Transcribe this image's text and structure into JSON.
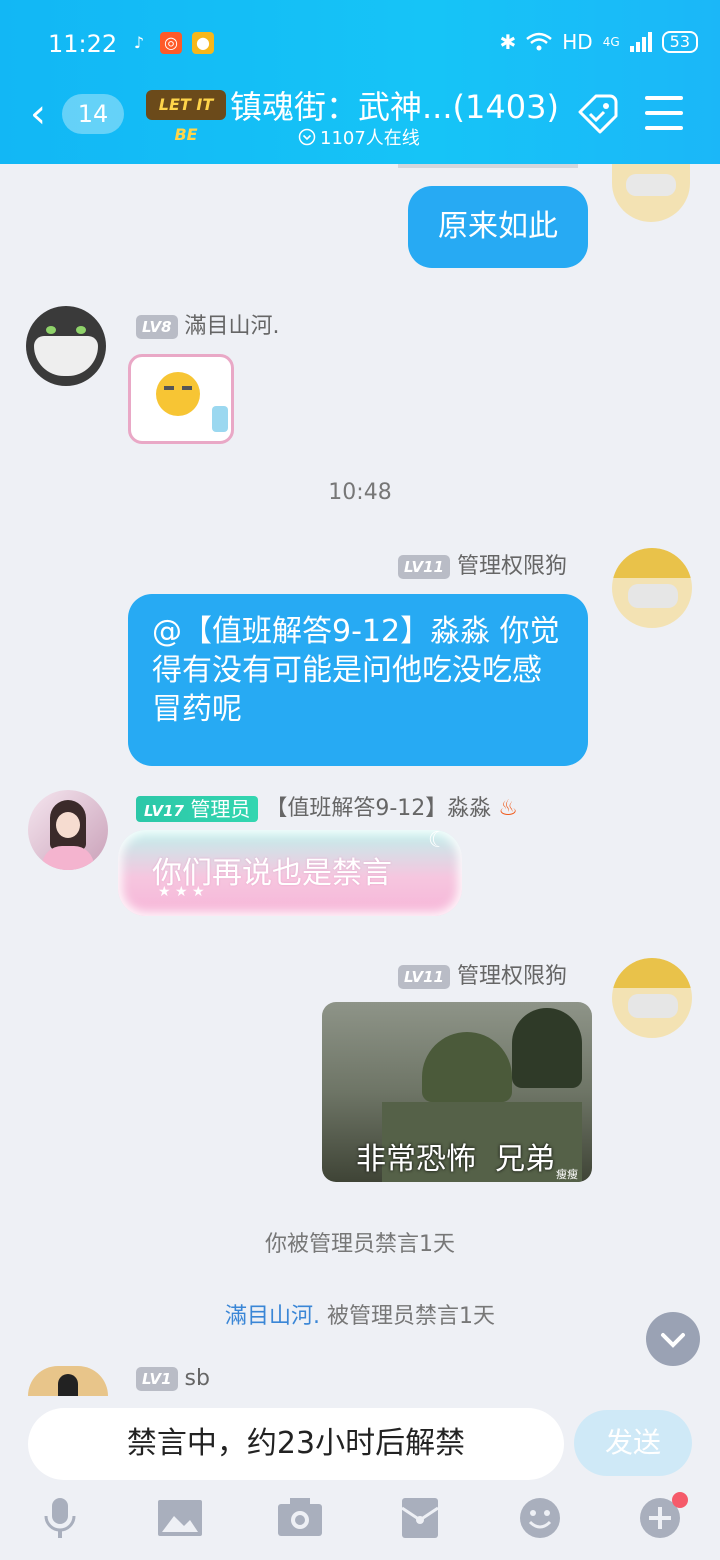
{
  "status_bar": {
    "time": "11:22",
    "network": "HD",
    "signal": "4G",
    "battery": "53"
  },
  "header": {
    "back_count": "14",
    "logo_text": "LET IT BE",
    "title": "镇魂街：武神...(1403)",
    "online": "1107人在线"
  },
  "messages": {
    "top_bubble": "原来如此",
    "m1": {
      "level": "LV8",
      "name": "滿目山河."
    },
    "time_divider": "10:48",
    "m2": {
      "level": "LV11",
      "name": "管理权限狗",
      "text": "@【值班解答9-12】淼淼 你觉得有没有可能是问他吃没吃感冒药呢"
    },
    "m3": {
      "level": "LV17",
      "role": "管理员",
      "name": "【值班解答9-12】淼淼",
      "text": "你们再说也是禁言"
    },
    "m4": {
      "level": "LV11",
      "name": "管理权限狗",
      "caption": "非常恐怖  兄弟",
      "watermark": "瘦瘦"
    },
    "sys1": "你被管理员禁言1天",
    "sys2_user": "滿目山河.",
    "sys2_rest": "被管理员禁言1天",
    "m5": {
      "level": "LV1",
      "name": "sb"
    }
  },
  "input": {
    "placeholder": "禁言中，约23小时后解禁",
    "send_label": "发送"
  },
  "colors": {
    "accent": "#12b7f5",
    "bubble": "#27aaf3",
    "link": "#3a86d6"
  }
}
